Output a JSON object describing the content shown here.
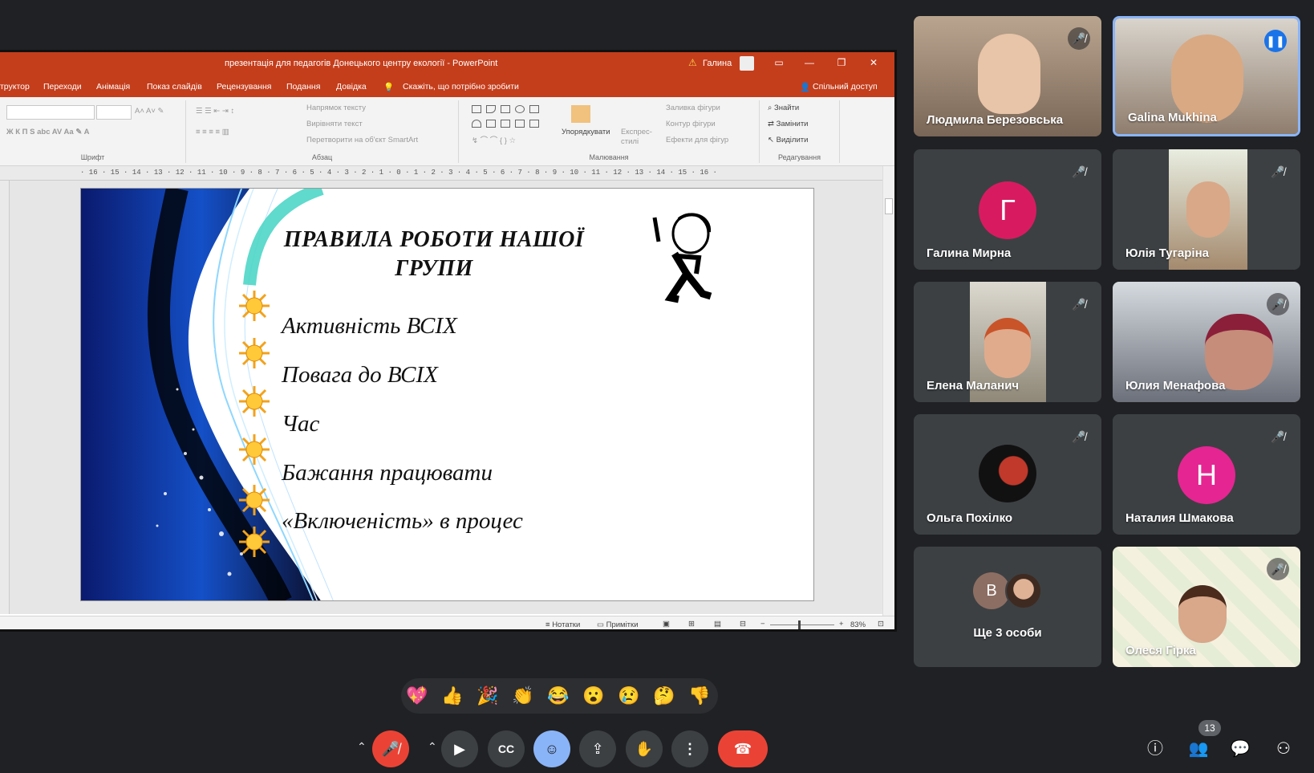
{
  "ppt": {
    "title": "презентація для педагогів Донецького центру екології  -  PowerPoint",
    "user": "Галина",
    "warning_icon": "warning-icon",
    "menu": [
      "труктор",
      "Переходи",
      "Анімація",
      "Показ слайдів",
      "Рецензування",
      "Подання",
      "Довідка"
    ],
    "tellme": "Скажіть, що потрібно зробити",
    "share_label": "Спільний доступ",
    "ribbon": {
      "font_label": "Шрифт",
      "paragraph_label": "Абзац",
      "drawing_label": "Малювання",
      "editing_label": "Редагування",
      "text_direction": "Напрямок тексту",
      "align_text": "Вирівняти текст",
      "smartart": "Перетворити на об'єкт SmartArt",
      "arrange": "Упорядкувати",
      "quick_styles": "Експрес-стилі",
      "shape_fill": "Заливка фігури",
      "shape_outline": "Контур фігури",
      "shape_effects": "Ефекти для фігур",
      "find": "Знайти",
      "replace": "Замінити",
      "select": "Виділити"
    },
    "ruler": "· 16 · 15 · 14 · 13 · 12 · 11 · 10 · 9 · 8 · 7 · 6 · 5 · 4 · 3 · 2 · 1 · 0 · 1 · 2 · 3 · 4 · 5 · 6 · 7 · 8 · 9 · 10 · 11 · 12 · 13 · 14 · 15 · 16 ·",
    "status": {
      "notes": "Нотатки",
      "comments": "Примітки",
      "zoom": "83%"
    }
  },
  "slide": {
    "title_line1": "ПРАВИЛА РОБОТИ  НАШОЇ",
    "title_line2": "ГРУПИ",
    "bullets": [
      "Активність ВСІХ",
      "Повага до ВСІХ",
      "Час",
      "Бажання працювати",
      "«Включеність» в процес"
    ]
  },
  "participants": [
    {
      "name": "Людмила Березовська",
      "muted": true
    },
    {
      "name": "Galina Mukhina",
      "muted": false,
      "speaking": true
    },
    {
      "name": "Галина Мирна",
      "initial": "Г",
      "color": "#d81b60",
      "muted": true
    },
    {
      "name": "Юлія Тугаріна",
      "muted": true
    },
    {
      "name": "Елена Маланич",
      "muted": true
    },
    {
      "name": "Юлия Менафова",
      "muted": true
    },
    {
      "name": "Ольга Похілко",
      "muted": true
    },
    {
      "name": "Наталия Шмакова",
      "initial": "Н",
      "color": "#e52592",
      "muted": true
    },
    {
      "name": "Ще 3 особи",
      "initial": "В"
    },
    {
      "name": "Олеся Гірка",
      "muted": true
    }
  ],
  "reactions": [
    "💖",
    "👍",
    "🎉",
    "👏",
    "😂",
    "😮",
    "😢",
    "🤔",
    "👎"
  ],
  "controls": {
    "people_count": "13",
    "icons": [
      "mic-off-icon",
      "camera-icon",
      "captions-icon",
      "emoji-icon",
      "present-icon",
      "hand-icon",
      "more-icon",
      "end-call-icon"
    ]
  }
}
